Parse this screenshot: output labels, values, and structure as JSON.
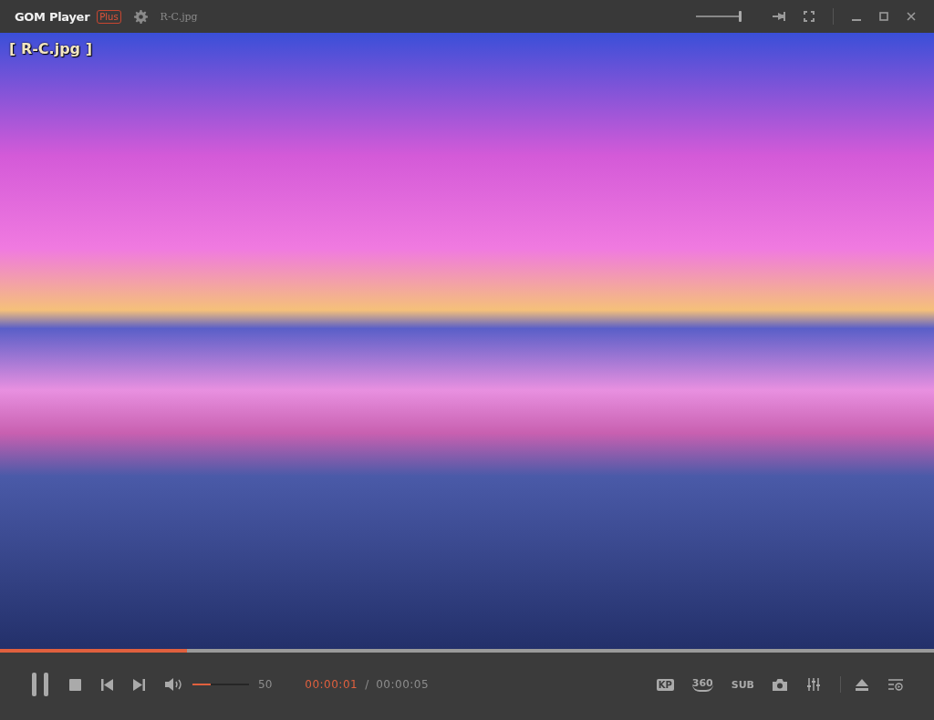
{
  "title_bar": {
    "app_name": "GOM Player",
    "badge": "Plus",
    "file_name": "R-C.jpg",
    "volume_slider": {
      "level": 1
    }
  },
  "viewer": {
    "overlay_label": "[ R-C.jpg ]"
  },
  "seek_bar": {
    "level": 0.2
  },
  "controls": {
    "volume": {
      "level": 0.33,
      "reading": "50"
    },
    "current_time": "00:00:01",
    "separator": "/",
    "total_time": "00:00:05",
    "tool_buttons": [
      {
        "label": "KP",
        "kind": "box"
      },
      {
        "label": "360",
        "kind": "arc"
      },
      {
        "label": "SUB",
        "kind": "plain"
      }
    ]
  }
}
